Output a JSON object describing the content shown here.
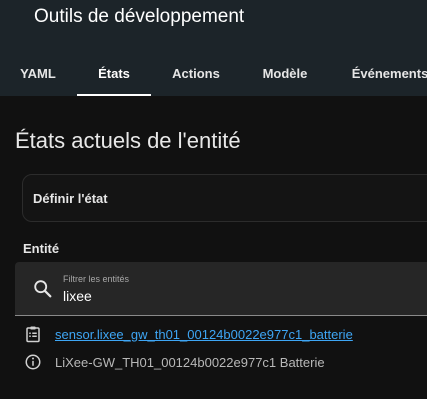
{
  "app": {
    "title": "Outils de développement"
  },
  "tabs": [
    {
      "label": "YAML",
      "active": false
    },
    {
      "label": "États",
      "active": true
    },
    {
      "label": "Actions",
      "active": false
    },
    {
      "label": "Modèle",
      "active": false
    },
    {
      "label": "Événements",
      "active": false
    }
  ],
  "main": {
    "heading": "États actuels de l'entité",
    "set_state_label": "Définir l'état",
    "entity_label": "Entité",
    "search": {
      "label": "Filtrer les entités",
      "value": "lixee",
      "icon": "search-icon"
    },
    "results": [
      {
        "icon": "clipboard-list-icon",
        "text": "sensor.lixee_gw_th01_00124b0022e977c1_batterie",
        "type": "link"
      },
      {
        "icon": "info-icon",
        "text": "LiXee-GW_TH01_00124b0022e977c1 Batterie",
        "type": "text"
      }
    ]
  },
  "colors": {
    "header_bg": "#1c2429",
    "page_bg": "#111111",
    "link": "#3ea6f5",
    "tab_indicator": "#ffffff"
  }
}
